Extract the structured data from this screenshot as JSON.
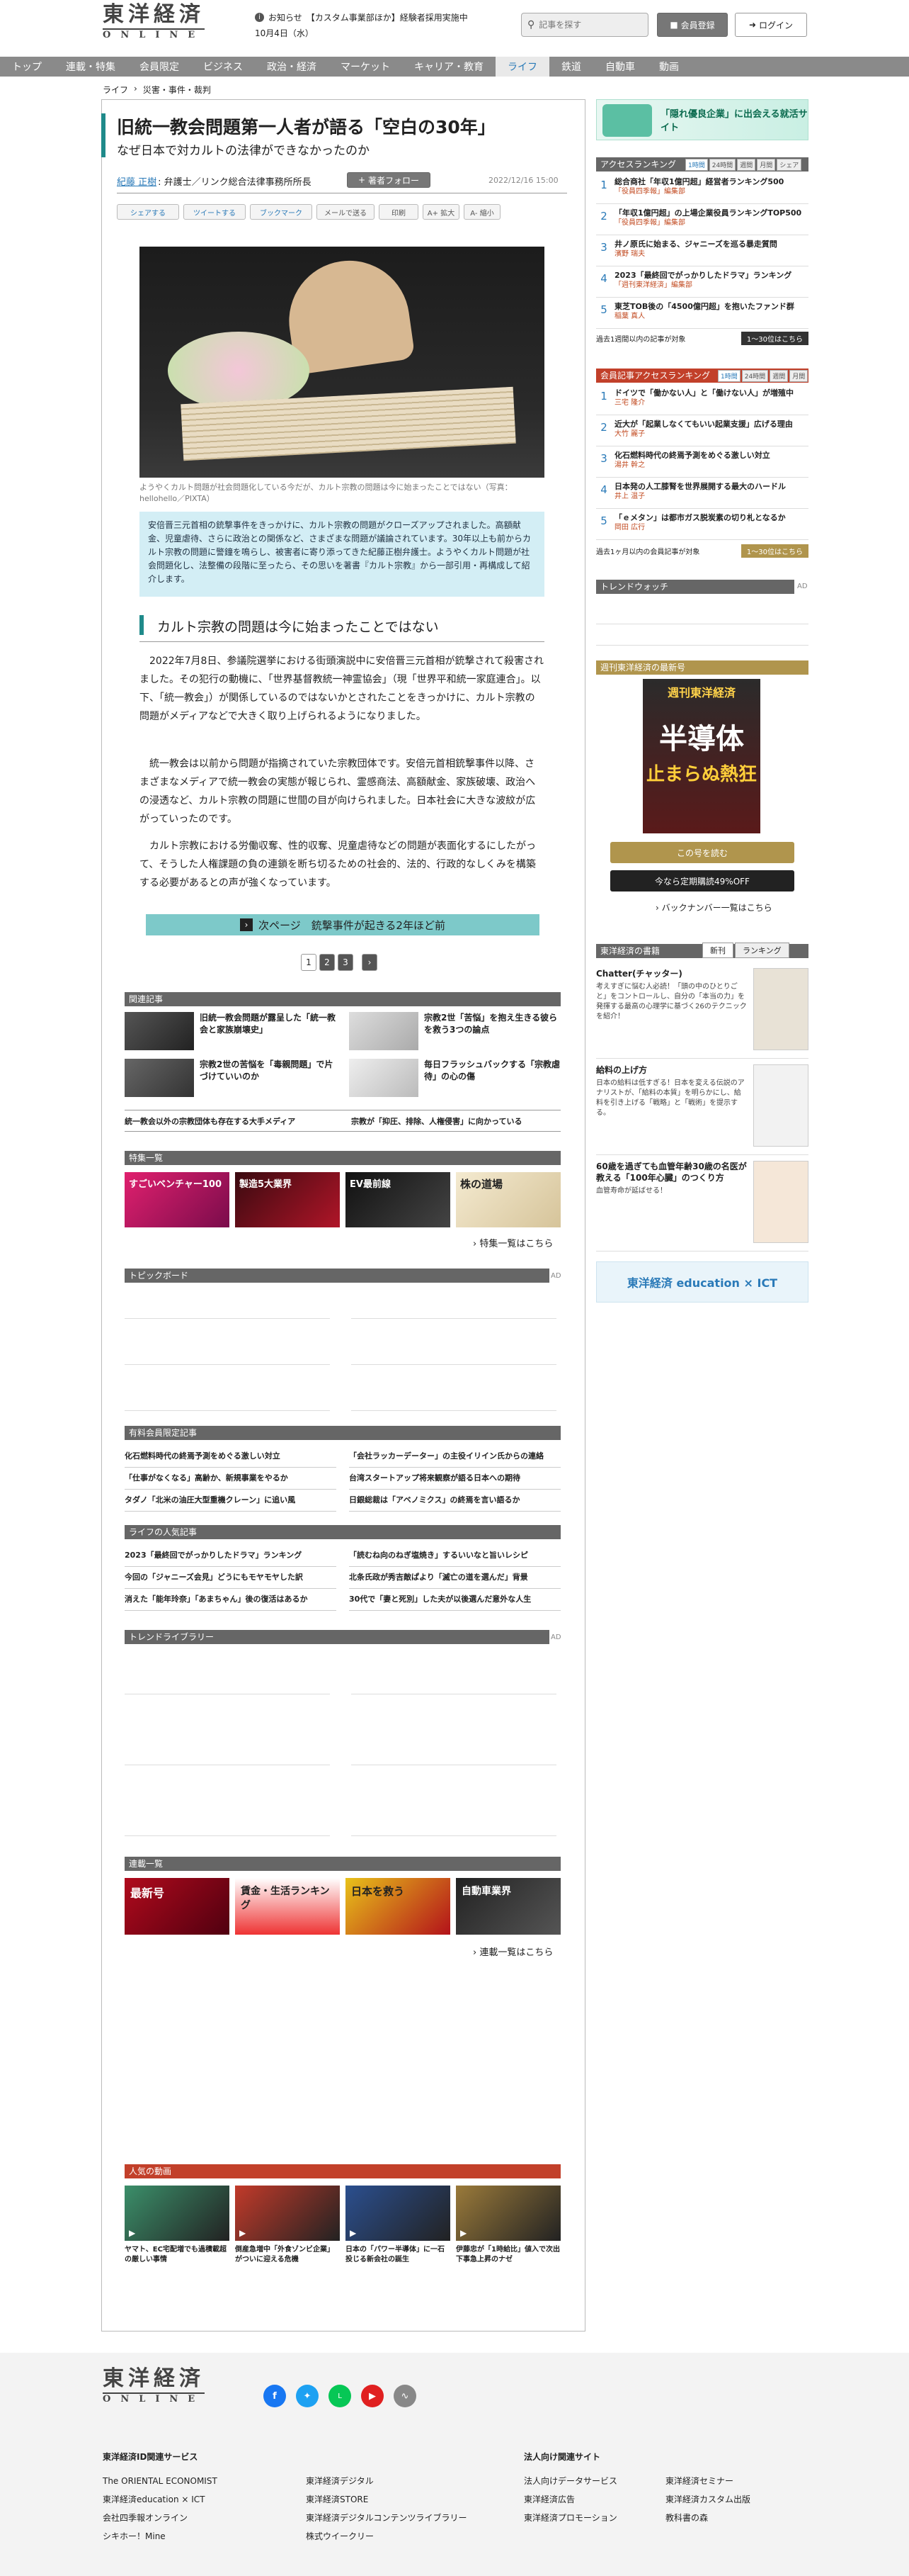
{
  "header": {
    "logo_big": "東洋経済",
    "logo_small": "ONLINE",
    "notice_label": "お知らせ",
    "notice_text": "【カスタム事業部ほか】経験者採用実施中",
    "date": "10月4日（水）",
    "search_placeholder": "記事を探す",
    "register_label": "会員登録",
    "login_label": "ログイン"
  },
  "nav": [
    "トップ",
    "連載・特集",
    "会員限定",
    "ビジネス",
    "政治・経済",
    "マーケット",
    "キャリア・教育",
    "ライフ",
    "鉄道",
    "自動車",
    "動画"
  ],
  "breadcrumb": [
    "ライフ",
    "災害・事件・裁判"
  ],
  "article": {
    "title": "旧統一教会問題第一人者が語る「空白の30年」",
    "subtitle": "なぜ日本で対カルトの法律ができなかったのか",
    "author_name": "紀藤 正樹",
    "author_role": ": 弁護士／リンク総合法律事務所所長",
    "follow_label": "著者フォロー",
    "date": "2022/12/16 15:00",
    "share": [
      "シェアする",
      "ツイートする",
      "ブックマーク",
      "メールで送る",
      "印刷",
      "A+ 拡大",
      "A- 縮小"
    ],
    "image_caption": "ようやくカルト問題が社会問題化している今だが、カルト宗教の問題は今に始まったことではない（写真：hellohello／PIXTA）",
    "lead": "安倍晋三元首相の銃撃事件をきっかけに、カルト宗教の問題がクローズアップされました。高額献金、児童虐待、さらに政治との関係など、さまざまな問題が議論されています。30年以上も前からカルト宗教の問題に警鐘を鳴らし、被害者に寄り添ってきた紀藤正樹弁護士。ようやくカルト問題が社会問題化し、法整備の段階に至ったら、その思いを著書『カルト宗教』から一部引用・再構成して紹介します。",
    "section_heading": "カルト宗教の問題は今に始まったことではない",
    "paragraphs": [
      "2022年7月8日、参議院選挙における街頭演説中に安倍晋三元首相が銃撃されて殺害されました。その犯行の動機に、「世界基督教統一神霊協会」（現「世界平和統一家庭連合」。以下、「統一教会」）が関係しているのではないかとされたことをきっかけに、カルト宗教の問題がメディアなどで大きく取り上げられるようになりました。",
      "統一教会は以前から問題が指摘されていた宗教団体です。安倍元首相銃撃事件以降、さまざまなメディアで統一教会の実態が報じられ、霊感商法、高額献金、家族破壊、政治への浸透など、カルト宗教の問題に世間の目が向けられました。日本社会に大きな波紋が広がっていったのです。",
      "カルト宗教における労働収奪、性的収奪、児童虐待などの問題が表面化するにしたがって、そうした人権課題の負の連鎖を断ち切るための社会的、法的、行政的なしくみを構築する必要があるとの声が強くなっています。"
    ],
    "next_page": "次ページ　銃撃事件が起きる2年ほど前",
    "pages": [
      "1",
      "2",
      "3"
    ]
  },
  "related": {
    "heading": "関連記事",
    "items": [
      "旧統一教会問題が露呈した「統一教会と家族崩壊史」",
      "宗教2世「苦悩」を抱え生きる彼らを救う3つの論点",
      "宗教2世の苦悩を「毒親問題」で片づけていいのか",
      "毎日フラッシュバックする「宗教虐待」の心の傷"
    ],
    "text_links": [
      "統一教会以外の宗教団体も存在する大手メディア",
      "宗教が「抑圧、排除、人権侵害」に向かっている"
    ]
  },
  "features": {
    "heading": "特集一覧",
    "more": "特集一覧はこちら",
    "banners": [
      "すごいベンチャー100",
      "製造5大業界",
      "EV最前線",
      "株の道場"
    ]
  },
  "topic_board": {
    "heading": "トピックボード",
    "ad": "AD"
  },
  "premium": {
    "heading": "有料会員限定記事",
    "items": [
      "化石燃料時代の終焉予測をめぐる激しい対立",
      "「会社ラッカーデーター」の主役イリイン氏からの連絡",
      "「仕事がなくなる」高齢か、新規事業をやるか",
      "台湾スタートアップ将来観察が語る日本への期待",
      "タダノ「北米の油圧大型重機クレーン」に追い風",
      "日銀総裁は「アベノミクス」の終焉を言い語るか"
    ]
  },
  "life_popular": {
    "heading": "ライフの人気記事",
    "items": [
      "2023「最終回でがっかりしたドラマ」ランキング",
      "「読むね向のねぎ塩焼き」するいいなと旨いレシピ",
      "今回の「ジャニーズ会見」どうにもモヤモヤした訳",
      "北条氏政が秀吉敵ぱより「滅亡の道を選んだ」背景",
      "消えた「能年玲奈」「あまちゃん」後の復活はあるか",
      "30代で「妻と死別」した夫が以後選んだ意外な人生"
    ]
  },
  "trend_library": {
    "heading": "トレンドライブラリー",
    "ad": "AD"
  },
  "series": {
    "heading": "連載一覧",
    "more": "連載一覧はこちら",
    "banners": [
      "最新号",
      "賃金・生活ランキング",
      "日本を救う",
      "自動車業界"
    ]
  },
  "popular_videos": {
    "heading": "人気の動画",
    "items": [
      "ヤマト、EC宅配増でも過積載超の厳しい事情",
      "倒産急増中「外食ゾンビ企業」がついに迎える危機",
      "日本の「パワー半導体」に一石投じる新会社の誕生",
      "伊藤忠が「1時給比」値入で次出下事急上昇のナゼ"
    ]
  },
  "sidebar": {
    "banner_text": "「隠れ優良企業」に出会える就活サイト",
    "access_ranking": {
      "heading": "アクセスランキング",
      "tabs": [
        "1時間",
        "24時間",
        "週間",
        "月間",
        "シェア"
      ],
      "items": [
        {
          "title": "総合商社「年収1億円超」経営者ランキング500",
          "sub": "「役員四季報」編集部"
        },
        {
          "title": "「年収1億円超」の上場企業役員ランキングTOP500",
          "sub": "「役員四季報」編集部"
        },
        {
          "title": "井ノ原氏に始まる、ジャニーズを巡る暴走質問",
          "sub": "濱野 瑞夫"
        },
        {
          "title": "2023「最終回でがっかりしたドラマ」ランキング",
          "sub": "「週刊東洋経済」編集部"
        },
        {
          "title": "東芝TOB後の「4500億円超」を抱いたファンド群",
          "sub": "稲葉 真人"
        }
      ],
      "footer": "過去1週間以内の記事が対象",
      "more": "1〜30位はこちら"
    },
    "premium_ranking": {
      "heading": "会員記事アクセスランキング",
      "tabs": [
        "1時間",
        "24時間",
        "週間",
        "月間"
      ],
      "items": [
        {
          "title": "ドイツで「働かない人」と「働けない人」が増殖中",
          "sub": "三宅 隆介"
        },
        {
          "title": "近大が「起業しなくてもいい起業支援」広げる理由",
          "sub": "大竹 麗子"
        },
        {
          "title": "化石燃料時代の終焉予測をめぐる激しい対立",
          "sub": "湯井 幹之"
        },
        {
          "title": "日本発の人工膝腎を世界展開する最大のハードル",
          "sub": "井上 温子"
        },
        {
          "title": "「ｅメタン」は都市ガス脱炭素の切り札となるか",
          "sub": "岡田 広行"
        }
      ],
      "footer": "過去1ヶ月以内の会員記事が対象",
      "more": "1〜30位はこちら"
    },
    "trend_watch": {
      "heading": "トレンドウォッチ",
      "ad": "AD"
    },
    "magazine": {
      "heading": "週刊東洋経済の最新号",
      "cover_title": "週刊東洋経済",
      "cover_main": "半導体",
      "cover_sub": "止まらぬ熱狂",
      "read_button": "この号を読む",
      "subscribe_button": "今なら定期購読49%OFF",
      "backnumber": "バックナンバー一覧はこちら"
    },
    "books": {
      "heading": "東洋経済の書籍",
      "tabs": [
        "新刊",
        "ランキング"
      ],
      "items": [
        {
          "title": "Chatter(チャッター)",
          "desc": "考えすぎに悩む人必読！「頭の中のひとりごと」をコントロールし、自分の「本当の力」を発揮する最高の心理学に基づく26のテクニックを紹介！"
        },
        {
          "title": "給料の上げ方",
          "desc": "日本の給料は低すぎる！日本を変える伝説のアナリストが、「給料の本質」を明らかにし、給料を引き上げる「戦略」と「戦術」を提示する。"
        },
        {
          "title": "60歳を過ぎても血管年齢30歳の名医が教える「100年心臓」のつくり方",
          "desc": "血管寿命が延ばせる！"
        }
      ]
    },
    "edu_banner": "東洋経済 education × ICT"
  },
  "footer": {
    "logo_big": "東洋経済",
    "logo_small": "ONLINE",
    "related_heading": "東洋経済ID関連サービス",
    "corp_heading": "法人向け関連サイト",
    "col1": [
      "The ORIENTAL ECONOMIST",
      "東洋経済education × ICT",
      "会社四季報オンライン",
      "シキホー！Mine"
    ],
    "col2": [
      "東洋経済デジタル",
      "東洋経済STORE",
      "東洋経済デジタルコンテンツライブラリー",
      "株式ウイークリー"
    ],
    "col3": [
      "法人向けデータサービス",
      "東洋経済広告",
      "東洋経済プロモーション"
    ],
    "col4": [
      "東洋経済セミナー",
      "東洋経済カスタム出版",
      "教科書の森"
    ]
  },
  "colors": {
    "accent_blue": "#2a7ab8",
    "teal": "#1f8a8a",
    "gold": "#b0954d",
    "nav_gray": "#8a8a8a"
  }
}
